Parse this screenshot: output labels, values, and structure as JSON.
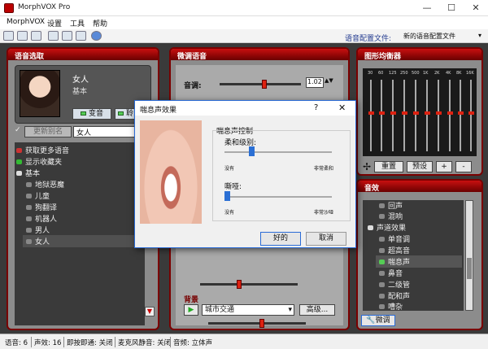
{
  "window": {
    "title": "MorphVOX Pro",
    "minimize": "—",
    "maximize": "☐",
    "close": "✕"
  },
  "menu": [
    "MorphVOX",
    "设置",
    "工具",
    "帮助"
  ],
  "toolbar": {
    "profile_label": "语音配置文件:",
    "profile_value": "新的语音配置文件"
  },
  "voice_panel": {
    "title": "语音选取",
    "voice_name": "女人",
    "voice_type": "基本",
    "morph_button": "变音",
    "listen_button": "聆",
    "alias_button": "更新别名",
    "alias_value": "女人",
    "tree": [
      {
        "label": "获取更多语音",
        "level": 0,
        "icon": "download-icon"
      },
      {
        "label": "显示收藏夹",
        "level": 0,
        "icon": "star-icon"
      },
      {
        "label": "基本",
        "level": 0,
        "icon": "collapse-icon"
      },
      {
        "label": "地狱恶魔",
        "level": 1,
        "icon": "voice-icon"
      },
      {
        "label": "儿童",
        "level": 1,
        "icon": "voice-icon"
      },
      {
        "label": "狗翻译",
        "level": 1,
        "icon": "voice-icon"
      },
      {
        "label": "机器人",
        "level": 1,
        "icon": "voice-icon"
      },
      {
        "label": "男人",
        "level": 1,
        "icon": "voice-icon"
      },
      {
        "label": "女人",
        "level": 1,
        "icon": "voice-icon",
        "selected": true
      }
    ]
  },
  "tune_panel": {
    "title": "微调语音",
    "pitch_label": "音调:",
    "pitch_value": "1.02",
    "pitch_level": 0.55,
    "background_label": "背景",
    "background_value": "城市交通",
    "advanced_button": "高级...",
    "sound_level": 0.4,
    "background_level": 0.55
  },
  "eq_panel": {
    "title": "图形均衡器",
    "bands": [
      "30",
      "60",
      "125",
      "250",
      "500",
      "1K",
      "2K",
      "4K",
      "8K",
      "16K"
    ],
    "reset_button": "重置",
    "preset_button": "预设",
    "plus_button": "+",
    "minus_button": "-"
  },
  "effects_panel": {
    "title": "音效",
    "items": [
      {
        "label": "回声",
        "level": 1
      },
      {
        "label": "混响",
        "level": 1
      },
      {
        "label": "声道效果",
        "level": 0
      },
      {
        "label": "单音调",
        "level": 1
      },
      {
        "label": "超高音",
        "level": 1
      },
      {
        "label": "喘息声",
        "level": 1,
        "selected": true
      },
      {
        "label": "鼻音",
        "level": 1
      },
      {
        "label": "二级管",
        "level": 1
      },
      {
        "label": "配和声",
        "level": 1
      },
      {
        "label": "嘈杂",
        "level": 1
      }
    ],
    "tweak_button": "微调"
  },
  "status": [
    "语音: 6",
    "声效: 16",
    "即按即通: 关闭",
    "麦克风静音: 关闭",
    "音频: 立体声"
  ],
  "dialog": {
    "title": "喘息声效果",
    "help": "?",
    "close": "✕",
    "group_label": "喘息声控制",
    "softness_label": "柔和级别:",
    "softness_min": "没有",
    "softness_max": "非常柔和",
    "softness_level": 0.25,
    "husk_label": "嘶哑:",
    "husk_min": "没有",
    "husk_max": "非常沙哑",
    "husk_level": 0.02,
    "ok_button": "好的",
    "cancel_button": "取消"
  }
}
